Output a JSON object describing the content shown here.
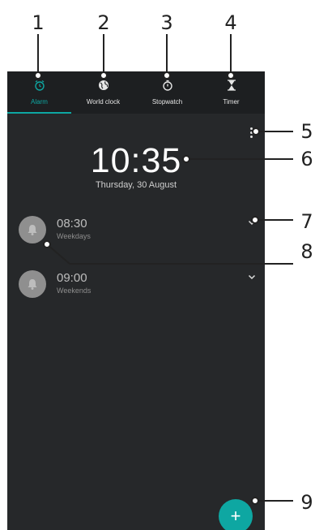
{
  "callouts": [
    "1",
    "2",
    "3",
    "4",
    "5",
    "6",
    "7",
    "8",
    "9"
  ],
  "tabs": [
    {
      "label": "Alarm",
      "icon": "alarm-clock-icon",
      "active": true
    },
    {
      "label": "World clock",
      "icon": "globe-icon",
      "active": false
    },
    {
      "label": "Stopwatch",
      "icon": "stopwatch-icon",
      "active": false
    },
    {
      "label": "Timer",
      "icon": "hourglass-icon",
      "active": false
    }
  ],
  "clock": {
    "time": "10:35",
    "date": "Thursday, 30 August"
  },
  "alarms": [
    {
      "time": "08:30",
      "days": "Weekdays"
    },
    {
      "time": "09:00",
      "days": "Weekends"
    }
  ],
  "fab": {
    "label": "+"
  },
  "colors": {
    "accent": "#0ea7a2",
    "background": "#26282a",
    "tab_bar": "#1d1f21"
  }
}
